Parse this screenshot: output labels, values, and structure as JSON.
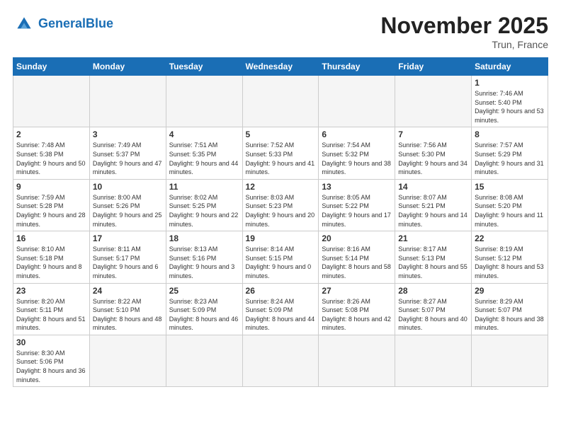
{
  "header": {
    "logo_general": "General",
    "logo_blue": "Blue",
    "month_title": "November 2025",
    "location": "Trun, France"
  },
  "days_of_week": [
    "Sunday",
    "Monday",
    "Tuesday",
    "Wednesday",
    "Thursday",
    "Friday",
    "Saturday"
  ],
  "weeks": [
    [
      {
        "day": null,
        "empty": true
      },
      {
        "day": null,
        "empty": true
      },
      {
        "day": null,
        "empty": true
      },
      {
        "day": null,
        "empty": true
      },
      {
        "day": null,
        "empty": true
      },
      {
        "day": null,
        "empty": true
      },
      {
        "day": 1,
        "sunrise": "7:46 AM",
        "sunset": "5:40 PM",
        "daylight": "9 hours and 53 minutes."
      }
    ],
    [
      {
        "day": 2,
        "sunrise": "7:48 AM",
        "sunset": "5:38 PM",
        "daylight": "9 hours and 50 minutes."
      },
      {
        "day": 3,
        "sunrise": "7:49 AM",
        "sunset": "5:37 PM",
        "daylight": "9 hours and 47 minutes."
      },
      {
        "day": 4,
        "sunrise": "7:51 AM",
        "sunset": "5:35 PM",
        "daylight": "9 hours and 44 minutes."
      },
      {
        "day": 5,
        "sunrise": "7:52 AM",
        "sunset": "5:33 PM",
        "daylight": "9 hours and 41 minutes."
      },
      {
        "day": 6,
        "sunrise": "7:54 AM",
        "sunset": "5:32 PM",
        "daylight": "9 hours and 38 minutes."
      },
      {
        "day": 7,
        "sunrise": "7:56 AM",
        "sunset": "5:30 PM",
        "daylight": "9 hours and 34 minutes."
      },
      {
        "day": 8,
        "sunrise": "7:57 AM",
        "sunset": "5:29 PM",
        "daylight": "9 hours and 31 minutes."
      }
    ],
    [
      {
        "day": 9,
        "sunrise": "7:59 AM",
        "sunset": "5:28 PM",
        "daylight": "9 hours and 28 minutes."
      },
      {
        "day": 10,
        "sunrise": "8:00 AM",
        "sunset": "5:26 PM",
        "daylight": "9 hours and 25 minutes."
      },
      {
        "day": 11,
        "sunrise": "8:02 AM",
        "sunset": "5:25 PM",
        "daylight": "9 hours and 22 minutes."
      },
      {
        "day": 12,
        "sunrise": "8:03 AM",
        "sunset": "5:23 PM",
        "daylight": "9 hours and 20 minutes."
      },
      {
        "day": 13,
        "sunrise": "8:05 AM",
        "sunset": "5:22 PM",
        "daylight": "9 hours and 17 minutes."
      },
      {
        "day": 14,
        "sunrise": "8:07 AM",
        "sunset": "5:21 PM",
        "daylight": "9 hours and 14 minutes."
      },
      {
        "day": 15,
        "sunrise": "8:08 AM",
        "sunset": "5:20 PM",
        "daylight": "9 hours and 11 minutes."
      }
    ],
    [
      {
        "day": 16,
        "sunrise": "8:10 AM",
        "sunset": "5:18 PM",
        "daylight": "9 hours and 8 minutes."
      },
      {
        "day": 17,
        "sunrise": "8:11 AM",
        "sunset": "5:17 PM",
        "daylight": "9 hours and 6 minutes."
      },
      {
        "day": 18,
        "sunrise": "8:13 AM",
        "sunset": "5:16 PM",
        "daylight": "9 hours and 3 minutes."
      },
      {
        "day": 19,
        "sunrise": "8:14 AM",
        "sunset": "5:15 PM",
        "daylight": "9 hours and 0 minutes."
      },
      {
        "day": 20,
        "sunrise": "8:16 AM",
        "sunset": "5:14 PM",
        "daylight": "8 hours and 58 minutes."
      },
      {
        "day": 21,
        "sunrise": "8:17 AM",
        "sunset": "5:13 PM",
        "daylight": "8 hours and 55 minutes."
      },
      {
        "day": 22,
        "sunrise": "8:19 AM",
        "sunset": "5:12 PM",
        "daylight": "8 hours and 53 minutes."
      }
    ],
    [
      {
        "day": 23,
        "sunrise": "8:20 AM",
        "sunset": "5:11 PM",
        "daylight": "8 hours and 51 minutes."
      },
      {
        "day": 24,
        "sunrise": "8:22 AM",
        "sunset": "5:10 PM",
        "daylight": "8 hours and 48 minutes."
      },
      {
        "day": 25,
        "sunrise": "8:23 AM",
        "sunset": "5:09 PM",
        "daylight": "8 hours and 46 minutes."
      },
      {
        "day": 26,
        "sunrise": "8:24 AM",
        "sunset": "5:09 PM",
        "daylight": "8 hours and 44 minutes."
      },
      {
        "day": 27,
        "sunrise": "8:26 AM",
        "sunset": "5:08 PM",
        "daylight": "8 hours and 42 minutes."
      },
      {
        "day": 28,
        "sunrise": "8:27 AM",
        "sunset": "5:07 PM",
        "daylight": "8 hours and 40 minutes."
      },
      {
        "day": 29,
        "sunrise": "8:29 AM",
        "sunset": "5:07 PM",
        "daylight": "8 hours and 38 minutes."
      }
    ],
    [
      {
        "day": 30,
        "sunrise": "8:30 AM",
        "sunset": "5:06 PM",
        "daylight": "8 hours and 36 minutes."
      },
      {
        "day": null,
        "empty": true
      },
      {
        "day": null,
        "empty": true
      },
      {
        "day": null,
        "empty": true
      },
      {
        "day": null,
        "empty": true
      },
      {
        "day": null,
        "empty": true
      },
      {
        "day": null,
        "empty": true
      }
    ]
  ]
}
